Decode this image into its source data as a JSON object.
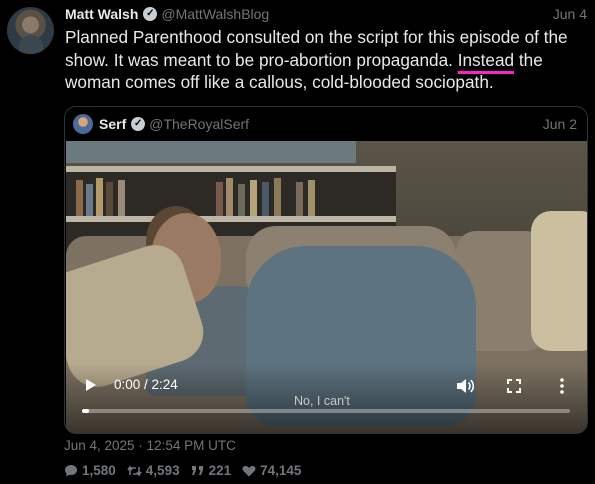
{
  "tweet": {
    "author_name": "Matt Walsh",
    "author_handle": "@MattWalshBlog",
    "date": "Jun 4",
    "text_before": "Planned Parenthood consulted on the script for this episode of the show. It was meant to be pro-abortion propaganda. ",
    "text_highlight": "Instead",
    "text_after": " the woman comes off like a callous, cold-blooded sociopath.",
    "highlight_color": "#ff20c8"
  },
  "quote": {
    "author_name": "Serf",
    "author_handle": "@TheRoyalSerf",
    "date": "Jun 2",
    "video": {
      "time": "0:00 / 2:24",
      "caption": "No, I can't",
      "progress": 0.015
    }
  },
  "footer": {
    "timestamp": "Jun 4, 2025 · 12:54 PM UTC",
    "replies": "1,580",
    "retweets": "4,593",
    "quotes": "221",
    "likes": "74,145"
  },
  "icons": {
    "verified": "verified-badge-icon",
    "reply": "comment-icon",
    "retweet": "retweet-icon",
    "quote": "quote-icon",
    "like": "heart-icon",
    "play": "play-icon",
    "volume": "volume-icon",
    "fullscreen": "fullscreen-icon",
    "more": "more-vertical-icon"
  },
  "colors": {
    "background": "#000000",
    "text": "#e7e9ea",
    "muted": "#71767b"
  }
}
